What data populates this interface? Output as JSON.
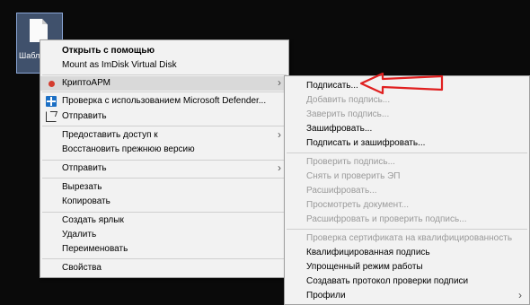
{
  "desktop_icon": {
    "label": "Шабл… xl"
  },
  "context_menu": {
    "open_with": "Открыть с помощью",
    "mount": "Mount as ImDisk Virtual Disk",
    "cryptoarm": "КриптоАРМ",
    "defender_scan": "Проверка с использованием Microsoft Defender...",
    "share": "Отправить",
    "give_access": "Предоставить доступ к",
    "restore": "Восстановить прежнюю версию",
    "send_to": "Отправить",
    "cut": "Вырезать",
    "copy": "Копировать",
    "create_shortcut": "Создать ярлык",
    "delete": "Удалить",
    "rename": "Переименовать",
    "properties": "Свойства"
  },
  "cryptoarm_submenu": {
    "items": [
      "Подписать...",
      "Добавить подпись...",
      "Заверить подпись...",
      "Зашифровать...",
      "Подписать и зашифровать...",
      "Проверить подпись...",
      "Снять и проверить ЭП",
      "Расшифровать...",
      "Просмотреть документ...",
      "Расшифровать и проверить подпись...",
      "Проверка сертификата на квалифицированность",
      "Квалифицированная подпись",
      "Упрощенный режим работы",
      "Создавать протокол проверки подписи",
      "Профили"
    ]
  },
  "colors": {
    "menu_bg": "#f2f2f2",
    "highlight": "#d9d9d9",
    "annotation_arrow": "#e02020",
    "cryptoarm_icon": "#d43c2e",
    "defender_icon": "#1c6fc4"
  }
}
